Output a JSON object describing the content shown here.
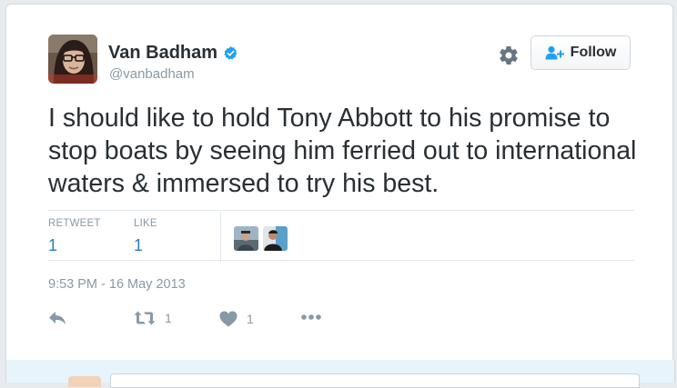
{
  "tweet": {
    "author": {
      "name": "Van Badham",
      "handle": "@vanbadham",
      "verified_icon": "verified-badge-icon"
    },
    "follow_label": "Follow",
    "text": "I should like to hold Tony Abbott to his promise to stop boats by seeing him ferried out to international waters & immersed to try his best.",
    "stats": {
      "retweet_label": "RETWEET",
      "retweet_count": "1",
      "like_label": "LIKE",
      "like_count": "1"
    },
    "timestamp": "9:53 PM - 16 May 2013",
    "actions": {
      "reply_icon": "reply-arrow-icon",
      "retweet_icon": "retweet-icon",
      "retweet_count": "1",
      "like_icon": "heart-icon",
      "like_count": "1",
      "more_icon": "more-dots-icon"
    }
  },
  "colors": {
    "link_blue": "#2b7bb9",
    "muted_text": "#8899a6",
    "verified_blue": "#1da1f2",
    "divider": "#e1e8ed",
    "reply_area": "#e8f4fb"
  }
}
